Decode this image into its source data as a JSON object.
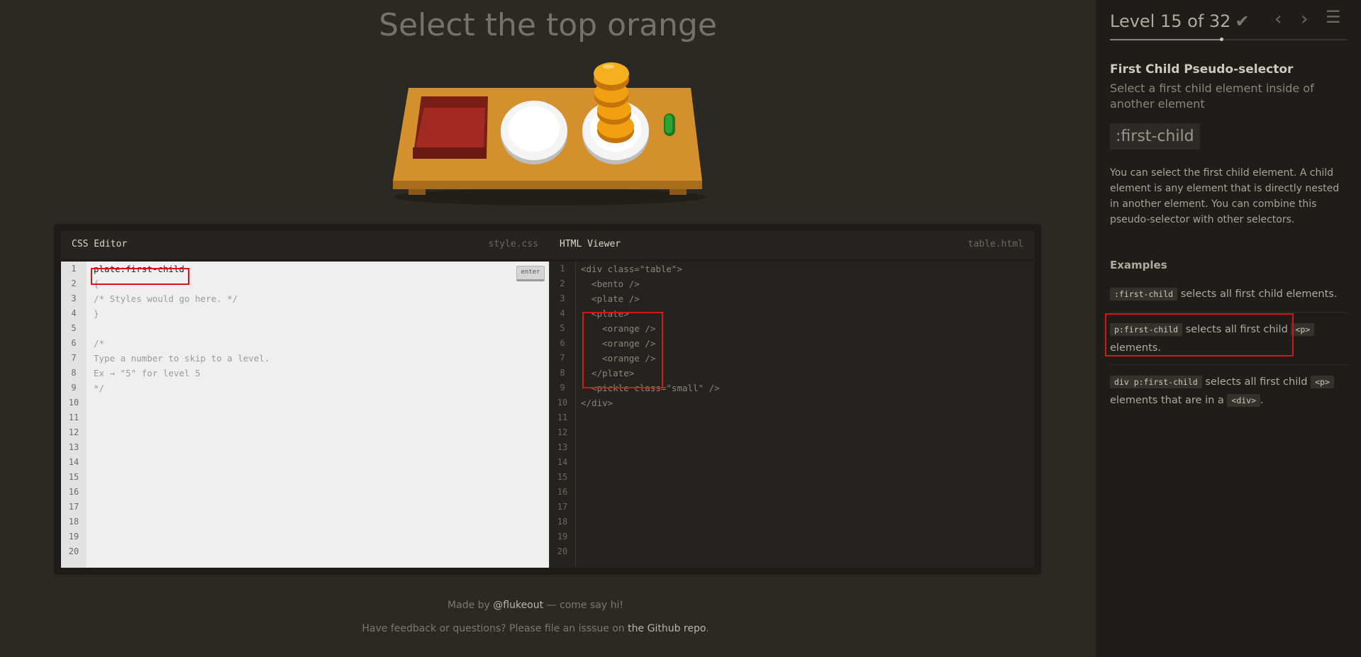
{
  "instruction": "Select the top orange",
  "editor": {
    "css_title": "CSS Editor",
    "css_file": "style.css",
    "enter_label": "enter",
    "css_lines": [
      "plate:first-child",
      "{",
      "/* Styles would go here. */",
      "}",
      "",
      "/*",
      "Type a number to skip to a level.",
      "Ex → \"5\" for level 5",
      "*/"
    ],
    "html_title": "HTML Viewer",
    "html_file": "table.html",
    "html_lines": [
      "<div class=\"table\">",
      "  <bento />",
      "  <plate />",
      "  <plate>",
      "    <orange />",
      "    <orange />",
      "    <orange />",
      "  </plate>",
      "  <pickle class=\"small\" />",
      "</div>"
    ],
    "line_numbers": [
      "1",
      "2",
      "3",
      "4",
      "5",
      "6",
      "7",
      "8",
      "9",
      "10",
      "11",
      "12",
      "13",
      "14",
      "15",
      "16",
      "17",
      "18",
      "19",
      "20"
    ]
  },
  "footer": {
    "made_by": "Made by",
    "author": "@flukeout",
    "say_hi": "— come say hi!",
    "feedback": "Have feedback or questions? Please file an isssue on",
    "repo": "the Github repo",
    "period": "."
  },
  "sidebar": {
    "level_text": "Level 15 of 32",
    "check_icon": "checkmark-icon",
    "progress_fraction": 0.469,
    "title": "First Child Pseudo-selector",
    "subtitle": "Select a first child element inside of another element",
    "syntax": ":first-child",
    "description": "You can select the first child element. A child element is any element that is directly nested in another element. You can combine this pseudo-selector with other selectors.",
    "examples_heading": "Examples",
    "examples": [
      {
        "code": ":first-child",
        "text": "selects all first child elements."
      },
      {
        "code": "p:first-child",
        "text1": "selects all first child",
        "code2": "<p>",
        "text2": "elements."
      },
      {
        "code": "div p:first-child",
        "text1": "selects all first child",
        "code2": "<p>",
        "text2": "elements that are in a",
        "code3": "<div>",
        "text3": "."
      }
    ]
  }
}
